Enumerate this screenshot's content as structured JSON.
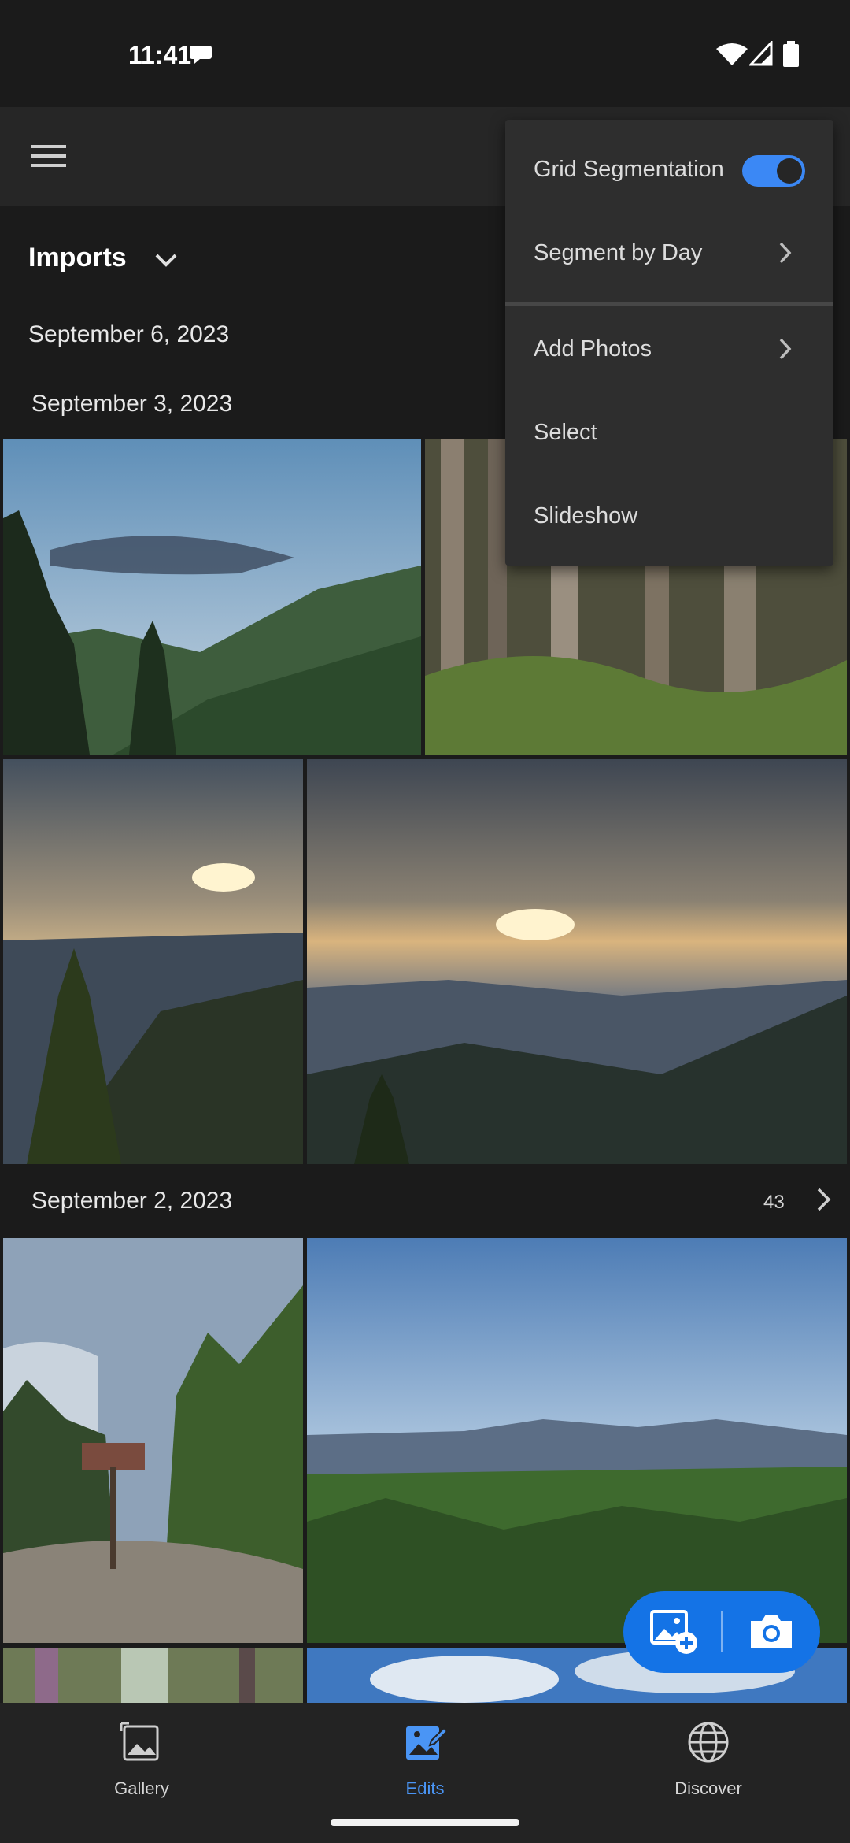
{
  "status_bar": {
    "time": "11:41",
    "icons": [
      "chat-bubble-icon",
      "wifi-icon",
      "signal-icon",
      "battery-icon"
    ]
  },
  "app_bar": {
    "icons": [
      "menu-icon"
    ]
  },
  "section": {
    "title": "Imports"
  },
  "groups": [
    {
      "date": "September 6, 2023"
    },
    {
      "date": "September 3, 2023"
    },
    {
      "date": "September 2, 2023",
      "count": "43"
    }
  ],
  "menu": {
    "items": [
      {
        "label": "Grid Segmentation",
        "toggle_on": true
      },
      {
        "label": "Segment by Day"
      },
      {
        "label": "Add Photos"
      },
      {
        "label": "Select"
      },
      {
        "label": "Slideshow"
      }
    ]
  },
  "fab": {
    "icons": [
      "add-photo-icon",
      "camera-icon"
    ]
  },
  "bottom_nav": {
    "items": [
      {
        "label": "Gallery",
        "icon": "gallery-icon",
        "active": false
      },
      {
        "label": "Edits",
        "icon": "edits-icon",
        "active": true
      },
      {
        "label": "Discover",
        "icon": "discover-icon",
        "active": false
      }
    ]
  },
  "colors": {
    "background": "#1b1b1b",
    "accent": "#1473e6",
    "active_tab": "#4a95f5"
  }
}
